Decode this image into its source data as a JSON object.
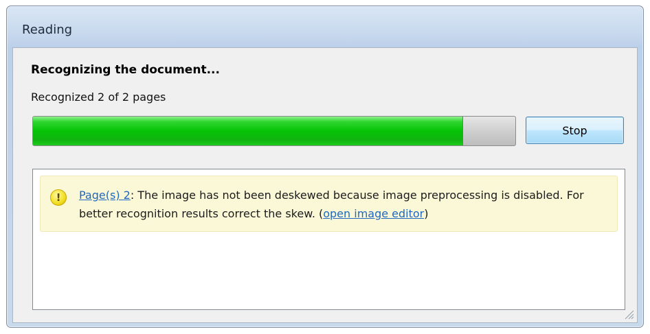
{
  "window": {
    "title": "Reading"
  },
  "progress_section": {
    "heading": "Recognizing the document...",
    "status": "Recognized 2 of 2 pages",
    "progress_percent": 89,
    "stop_label": "Stop"
  },
  "messages": [
    {
      "icon": "warning-icon",
      "icon_glyph": "!",
      "pages_link": "Page(s) 2",
      "text_before_link": ": The image has not been deskewed because image preprocessing is disabled. For better recognition results correct the skew. (",
      "editor_link": "open image editor",
      "text_after_link": ")"
    }
  ],
  "colors": {
    "progress_fill": "#06c306",
    "link": "#1f67c2",
    "message_background": "#fbf8d8"
  }
}
